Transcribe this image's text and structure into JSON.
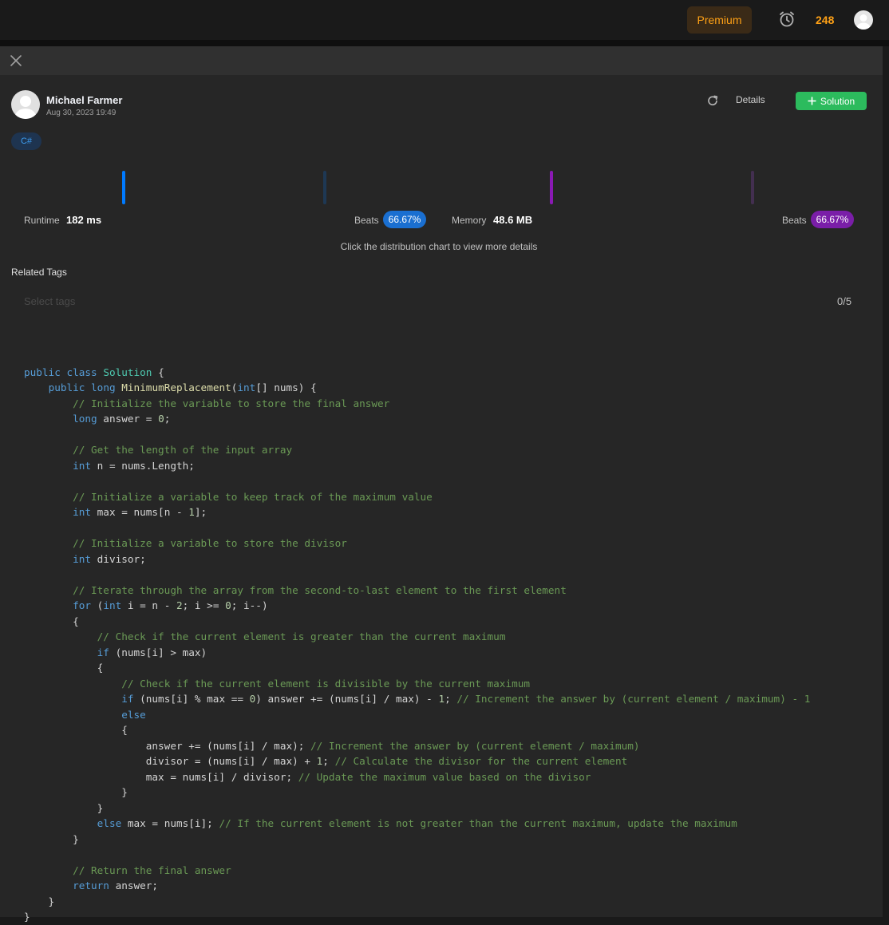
{
  "header": {
    "premium_label": "Premium",
    "streak_count": "248",
    "icons": {
      "timer": "alarm-clock-icon",
      "avatar": "user-avatar-icon"
    }
  },
  "panel": {
    "close_icon": "close-icon",
    "author": {
      "name": "Michael Farmer",
      "date": "Aug 30, 2023 19:49"
    },
    "actions": {
      "details_label": "Details",
      "solution_label": "Solution",
      "refresh_icon": "refresh-icon",
      "plus_icon": "plus-icon"
    },
    "language_tag": "C#",
    "runtime": {
      "label": "Runtime",
      "value": "182 ms",
      "beats_label": "Beats",
      "beats_value": "66.67%"
    },
    "memory": {
      "label": "Memory",
      "value": "48.6 MB",
      "beats_label": "Beats",
      "beats_value": "66.67%"
    },
    "chart_hint": "Click the distribution chart to view more details",
    "related_tags": {
      "title": "Related Tags",
      "placeholder": "Select tags",
      "count": "0/5"
    },
    "colors": {
      "accent_green": "#2cbb5d",
      "runtime_blue": "#007aff",
      "memory_purple": "#8a19b4",
      "premium_orange": "#ffa116"
    }
  },
  "code": {
    "language": "csharp",
    "lines": [
      "",
      "public class Solution {",
      "    public long MinimumReplacement(int[] nums) {",
      "        // Initialize the variable to store the final answer",
      "        long answer = 0;",
      "",
      "        // Get the length of the input array",
      "        int n = nums.Length;",
      "",
      "        // Initialize a variable to keep track of the maximum value",
      "        int max = nums[n - 1];",
      "",
      "        // Initialize a variable to store the divisor",
      "        int divisor;",
      "",
      "        // Iterate through the array from the second-to-last element to the first element",
      "        for (int i = n - 2; i >= 0; i--)",
      "        {",
      "            // Check if the current element is greater than the current maximum",
      "            if (nums[i] > max)",
      "            {",
      "                // Check if the current element is divisible by the current maximum",
      "                if (nums[i] % max == 0) answer += (nums[i] / max) - 1; // Increment the answer by (current element / maximum) - 1",
      "                else",
      "                {",
      "                    answer += (nums[i] / max); // Increment the answer by (current element / maximum)",
      "                    divisor = (nums[i] / max) + 1; // Calculate the divisor for the current element",
      "                    max = nums[i] / divisor; // Update the maximum value based on the divisor",
      "                }",
      "            }",
      "            else max = nums[i]; // If the current element is not greater than the current maximum, update the maximum",
      "        }",
      "",
      "        // Return the final answer",
      "        return answer;",
      "    }",
      "}"
    ]
  }
}
